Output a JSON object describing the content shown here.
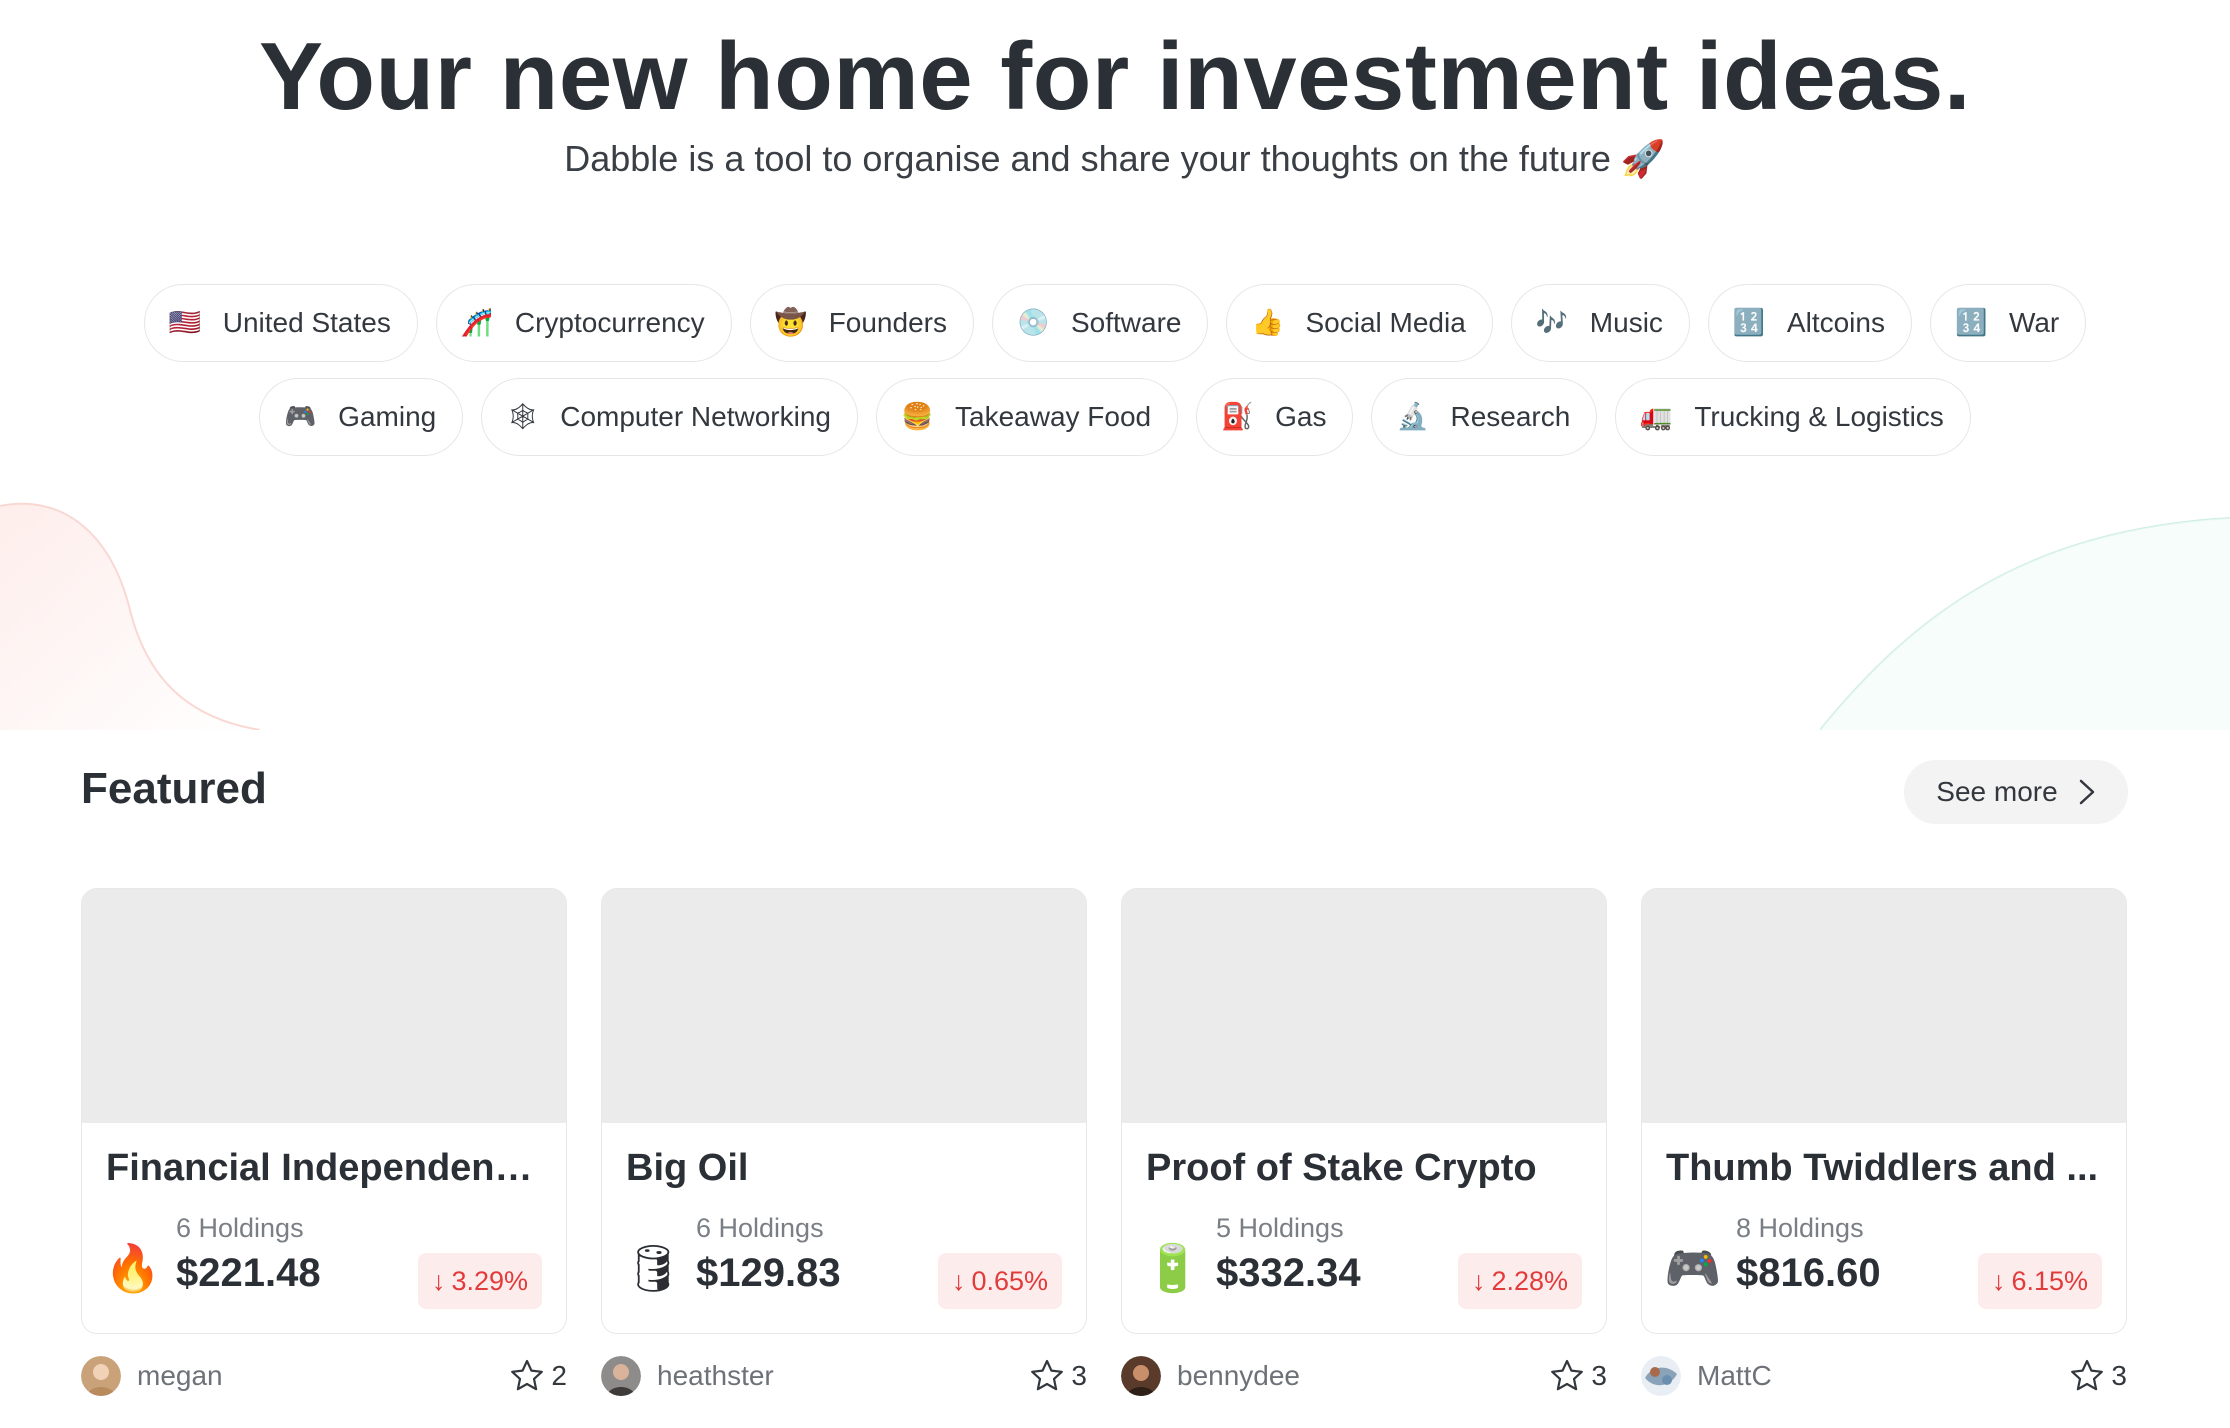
{
  "hero": {
    "title": "Your new home for investment ideas.",
    "subtitle": "Dabble is a tool to organise and share your thoughts on the future 🚀"
  },
  "tags_row1": [
    {
      "label": "United States",
      "icon": "🇺🇸",
      "icon_name": "us-flag-icon"
    },
    {
      "label": "Cryptocurrency",
      "icon": "🎢",
      "icon_name": "rollercoaster-icon"
    },
    {
      "label": "Founders",
      "icon": "🤠",
      "icon_name": "cowboy-face-icon"
    },
    {
      "label": "Software",
      "icon": "💿",
      "icon_name": "disc-icon"
    },
    {
      "label": "Social Media",
      "icon": "👍",
      "icon_name": "thumbs-up-icon"
    },
    {
      "label": "Music",
      "icon": "🎶",
      "icon_name": "music-notes-icon"
    },
    {
      "label": "Altcoins",
      "icon": "🔢",
      "icon_name": "binary-icon"
    },
    {
      "label": "War",
      "icon": "🔢",
      "icon_name": "binary-icon"
    }
  ],
  "tags_row2": [
    {
      "label": "Gaming",
      "icon": "🎮",
      "icon_name": "gamepad-icon"
    },
    {
      "label": "Computer Networking",
      "icon": "🕸",
      "icon_name": "spider-web-icon"
    },
    {
      "label": "Takeaway Food",
      "icon": "🍔",
      "icon_name": "burger-icon"
    },
    {
      "label": "Gas",
      "icon": "⛽",
      "icon_name": "fuel-pump-icon"
    },
    {
      "label": "Research",
      "icon": "🔬",
      "icon_name": "microscope-icon"
    },
    {
      "label": "Trucking & Logistics",
      "icon": "🚛",
      "icon_name": "truck-icon"
    }
  ],
  "featured": {
    "title": "Featured",
    "see_more": "See more"
  },
  "cards": [
    {
      "name": "Financial Independence...",
      "emoji": "🔥",
      "emoji_name": "fire-icon",
      "holdings": "6 Holdings",
      "price": "$221.48",
      "change": "3.29%",
      "author": "megan",
      "stars": "2",
      "avatar_color": "#c9a27a"
    },
    {
      "name": "Big Oil",
      "emoji": "🛢",
      "emoji_name": "oil-drum-icon",
      "holdings": "6 Holdings",
      "price": "$129.83",
      "change": "0.65%",
      "author": "heathster",
      "stars": "3",
      "avatar_color": "#6b5547"
    },
    {
      "name": "Proof of Stake Crypto",
      "emoji": "🔋",
      "emoji_name": "battery-icon",
      "holdings": "5 Holdings",
      "price": "$332.34",
      "change": "2.28%",
      "author": "bennydee",
      "stars": "3",
      "avatar_color": "#5a3a2a"
    },
    {
      "name": "Thumb Twiddlers and ...",
      "emoji": "🎮",
      "emoji_name": "gamepad-icon",
      "holdings": "8 Holdings",
      "price": "$816.60",
      "change": "6.15%",
      "author": "MattC",
      "stars": "3",
      "avatar_color": "#8aa3b8"
    }
  ],
  "colors": {
    "negative": "#e23b3b",
    "negative_bg": "#fdecec",
    "thumb_bg": "#ebebeb"
  }
}
